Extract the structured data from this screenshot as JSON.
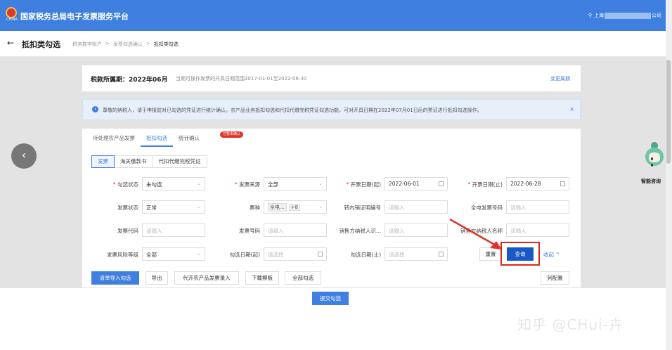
{
  "app": {
    "title": "国家税务总局电子发票服务平台",
    "logo_caption": "CHINA",
    "user_prefix": "上海",
    "user_suffix": "公司"
  },
  "header": {
    "back_glyph": "←",
    "page_title": "抵扣类勾选",
    "breadcrumbs": [
      "税务数字账户",
      ">",
      "发票勾选确认",
      ">",
      "抵扣类勾选"
    ]
  },
  "period": {
    "label": "税款所属期：2022年06月",
    "note": "当期可操作发票的开具日期范围2017-01-01至2022-06-30",
    "change_link": "变更属期"
  },
  "notice": {
    "text": "尊敬的纳税人，请于申报前对已勾选的凭证进行统计确认。农产品业务抵扣勾选和代扣代缴完税凭证勾选功能，可对开具日期在2022年07月01日后的票证进行抵扣勾选操作。",
    "close": "×"
  },
  "tabs": [
    "待处理农产品发票",
    "抵扣勾选",
    "统计确认"
  ],
  "tab_badge": "已暂未确认",
  "subtabs": [
    "发票",
    "海关缴款书",
    "代扣代缴完税凭证"
  ],
  "form": {
    "check_status": {
      "label": "勾选状态",
      "value": "未勾选"
    },
    "invoice_source": {
      "label": "发票来源",
      "value": "全部"
    },
    "issue_date_from": {
      "label": "开票日期(起)",
      "value": "2022-06-01"
    },
    "issue_date_to": {
      "label": "开票日期(止)",
      "value": "2022-06-28"
    },
    "invoice_status": {
      "label": "发票状态",
      "value": "正常"
    },
    "invoice_type": {
      "label": "票种",
      "tag": "全电...",
      "more": "+8"
    },
    "transfer_cert": {
      "label": "转内销证明编号",
      "placeholder": "请输入"
    },
    "einvoice_no": {
      "label": "全电发票号码",
      "placeholder": "请输入"
    },
    "invoice_code": {
      "label": "发票代码",
      "placeholder": "请输入"
    },
    "invoice_no": {
      "label": "发票号码",
      "placeholder": "请输入"
    },
    "seller_tax_id": {
      "label": "销售方纳税人识...",
      "placeholder": "请输入"
    },
    "seller_name": {
      "label": "销售方纳税人名称",
      "placeholder": "请输入"
    },
    "risk_level": {
      "label": "发票风险等级",
      "value": "全部"
    },
    "check_date_from": {
      "label": "勾选日期(起)",
      "placeholder": "请选择"
    },
    "check_date_to": {
      "label": "勾选日期(止)",
      "placeholder": "请选择"
    }
  },
  "actions": {
    "reset": "重置",
    "query": "查询",
    "collapse": "收起 ^"
  },
  "toolbar": [
    "清单导入勾选",
    "导出",
    "代开农产品发票录入",
    "下载模板",
    "全部勾选"
  ],
  "column_config": "列配置",
  "submit": "提交勾选",
  "widgets": {
    "left_nav": "‹",
    "assistant_label": "智能咨询"
  },
  "watermark": "知乎 @CHui-卉",
  "colors": {
    "primary": "#3e7fe0",
    "query": "#1659c7",
    "highlight": "#d6281f"
  }
}
